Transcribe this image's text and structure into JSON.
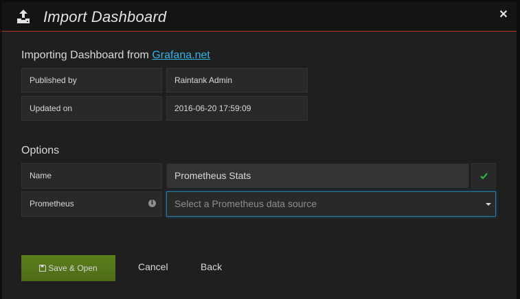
{
  "header": {
    "title": "Import Dashboard",
    "icon": "upload-icon",
    "close_icon": "close-icon"
  },
  "import_info": {
    "heading_prefix": "Importing Dashboard from ",
    "source_link": "Grafana.net",
    "rows": [
      {
        "label": "Published by",
        "value": "Raintank Admin"
      },
      {
        "label": "Updated on",
        "value": "2016-06-20 17:59:09"
      }
    ]
  },
  "options": {
    "heading": "Options",
    "name_label": "Name",
    "name_value": "Prometheus Stats",
    "datasource_label": "Prometheus",
    "datasource_placeholder": "Select a Prometheus data source"
  },
  "actions": {
    "save_label": "Save & Open",
    "cancel_label": "Cancel",
    "back_label": "Back"
  },
  "colors": {
    "accent_link": "#33b5e5",
    "header_border": "#b3381e",
    "save_button": "#55751a",
    "valid_check": "#2fb34a"
  }
}
